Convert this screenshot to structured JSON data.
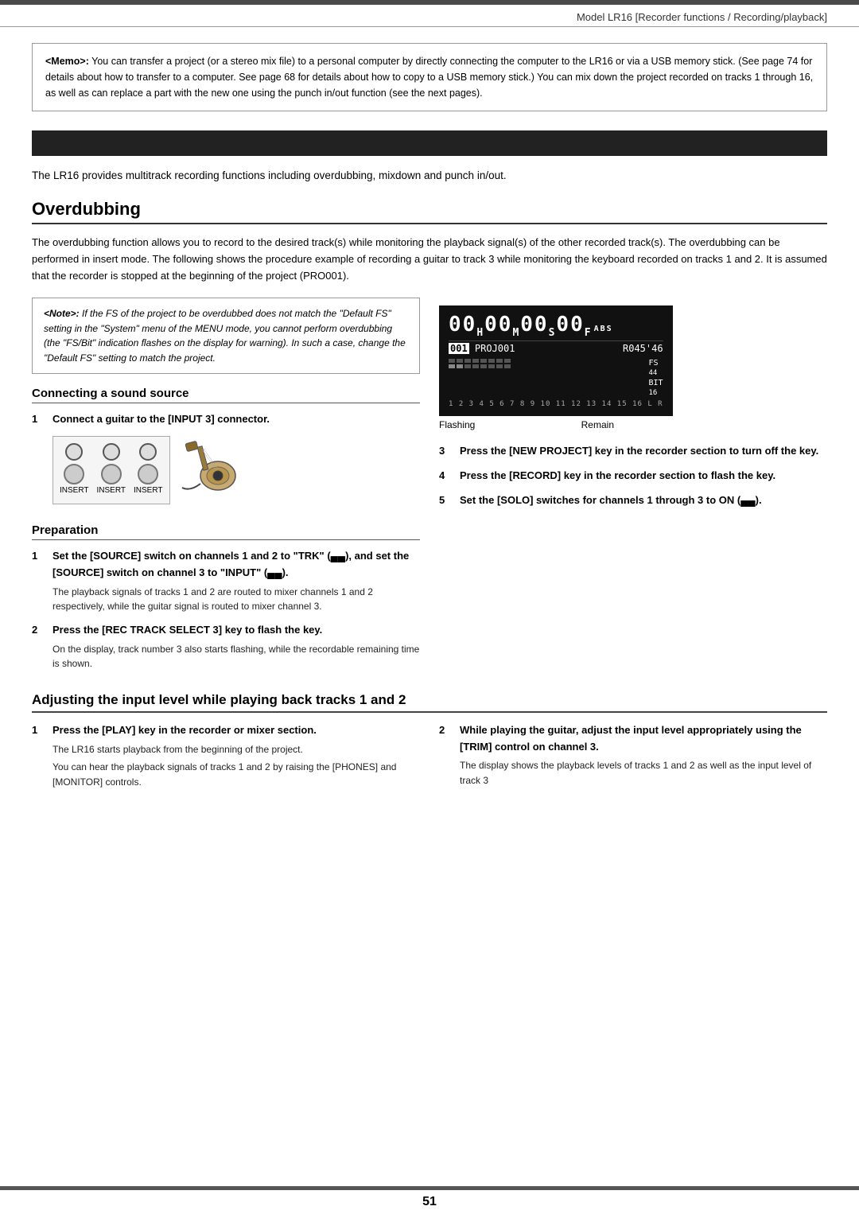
{
  "header": {
    "title": "Model LR16 [Recorder functions / Recording/playback]"
  },
  "memo": {
    "label": "<Memo>:",
    "text": "You can transfer a project (or a stereo mix file) to a personal computer by directly connecting the computer to the LR16 or via a USB memory stick. (See page 74 for details about how to transfer to a computer. See page 68 for details about how to copy to a USB memory stick.) You can mix down the project recorded on tracks 1 through 16, as well as can replace a part with the new one using the punch in/out function (see the next pages)."
  },
  "intro_text": "The LR16 provides multitrack recording functions including overdubbing, mixdown and punch in/out.",
  "overdubbing": {
    "heading": "Overdubbing",
    "body": "The overdubbing function allows you to record to the desired track(s) while monitoring the playback signal(s) of the other recorded track(s). The overdubbing can be performed in insert mode.  The following shows the procedure example of recording a guitar to track 3 while monitoring the keyboard recorded on tracks 1 and 2. It is assumed that the recorder is stopped at the beginning of the project (PRO001)."
  },
  "note_box": {
    "label": "<Note>:",
    "text": "If the FS of the project to be overdubbed does not match the \"Default FS\" setting in the \"System\" menu of the MENU mode, you cannot perform overdubbing (the \"FS/Bit\" indication flashes on the display for warning). In such a case, change the \"Default FS\" setting to match the project."
  },
  "display": {
    "time": "00H00M00S00F",
    "superscript": "ABS",
    "proj_line": "001 PROJ001",
    "remain_line": "R045'46",
    "label_flashing": "Flashing",
    "label_remain": "Remain",
    "fs_label": "FS",
    "bit_label": "BIT"
  },
  "connecting": {
    "heading": "Connecting a sound source",
    "step1_num": "1",
    "step1_text": "Connect a guitar to the [INPUT 3] connector."
  },
  "preparation": {
    "heading": "Preparation",
    "step1_num": "1",
    "step1_bold": "Set the [SOURCE] switch on channels 1 and 2 to \"TRK\" (▄▄), and set the [SOURCE] switch on channel 3 to \"INPUT\" (▄▄).",
    "step1_sub": "The playback signals of tracks 1 and 2 are routed to mixer channels 1 and 2 respectively, while the guitar signal is routed to mixer channel 3.",
    "step2_num": "2",
    "step2_bold": "Press the [REC TRACK SELECT 3] key to flash the key.",
    "step2_sub": "On the display, track number 3 also starts flashing, while the recordable remaining time is shown."
  },
  "right_col": {
    "step3_num": "3",
    "step3_bold": "Press the [NEW PROJECT] key in the recorder section to turn off the key.",
    "step4_num": "4",
    "step4_bold": "Press the [RECORD] key in the recorder section to flash the key.",
    "step5_num": "5",
    "step5_bold": "Set the [SOLO] switches for channels 1 through 3 to ON (▄▄)."
  },
  "adjusting": {
    "heading": "Adjusting the input level while playing back tracks 1 and 2",
    "step1_num": "1",
    "step1_bold": "Press the [PLAY] key in the recorder or mixer section.",
    "step1_sub1": "The LR16 starts playback from the beginning of the project.",
    "step1_sub2": "You can hear the playback signals of tracks 1 and 2 by raising the [PHONES] and [MONITOR] controls.",
    "step2_num": "2",
    "step2_bold": "While playing the guitar, adjust the input level appropriately using the [TRIM] control on channel 3.",
    "step2_sub": "The display shows the playback levels of tracks 1 and 2 as well as the input level of track 3"
  },
  "page_number": "51"
}
